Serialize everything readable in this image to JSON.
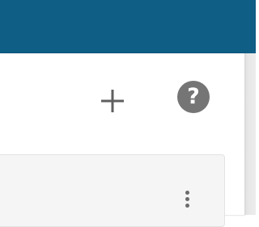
{
  "header": {
    "bar_color": "#0e5e86"
  },
  "toolbar": {
    "add_icon": "plus-icon",
    "help_icon": "help-circle-icon",
    "help_glyph": "?"
  },
  "card": {
    "menu_icon": "more-vert-icon"
  },
  "colors": {
    "icon_gray": "#757575",
    "card_background": "#f5f5f5"
  }
}
